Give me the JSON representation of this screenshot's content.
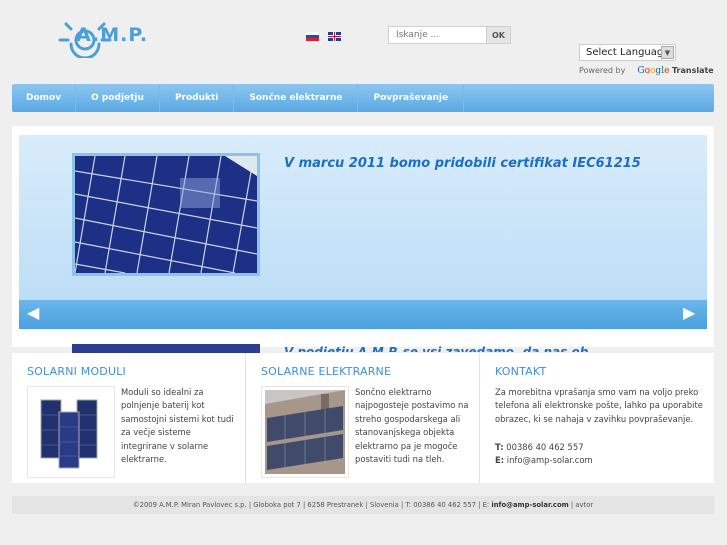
{
  "header": {
    "logo_text": "A.M.P.",
    "search": {
      "placeholder": "Iskanje ...",
      "button_label": "OK"
    },
    "language_select": {
      "selected": "Select Language"
    },
    "powered_by": "Powered by",
    "google": [
      "G",
      "o",
      "o",
      "g",
      "l",
      "e"
    ],
    "translate": "Translate",
    "flags": [
      "flag-si-icon",
      "flag-gb-icon"
    ]
  },
  "nav": {
    "items": [
      {
        "label": "Domov"
      },
      {
        "label": "O podjetju"
      },
      {
        "label": "Produkti"
      },
      {
        "label": "Sončne elektrarne"
      },
      {
        "label": "Povpraševanje"
      }
    ]
  },
  "slider": {
    "current_title": "V marcu 2011 bomo pridobili certifikat IEC61215",
    "next_title": "V podjetju A.M.P. se vsi zavedamo, da nas ob kakovostnih",
    "prev_arrow": "◀",
    "next_arrow": "▶"
  },
  "boxes": {
    "solar_modules": {
      "title": "SOLARNI MODULI",
      "text": "Moduli so idealni za polnjenje baterij kot samostojni sistemi kot tudi za večje sisteme integrirane v solarne elektrarne."
    },
    "solar_plants": {
      "title": "SOLARNE ELEKTRARNE",
      "text": "Sončno elektrarno najpogosteje postavimo na streho gospodarskega ali stanovanjskega objekta elektrarno pa je mogoče postaviti tudi na tleh."
    },
    "contact": {
      "title": "KONTAKT",
      "text": "Za morebitna vprašanja smo vam na voljo preko telefona ali elektronske pošte, lahko pa uporabite obrazec, ki se nahaja v zavihku povpraševanje.",
      "phone_label": "T:",
      "phone": "00386 40 462 557",
      "email_label": "E:",
      "email": "info@amp-solar.com"
    }
  },
  "footer": {
    "text": "©2009 A.M.P. Miran Pavlovec s.p. | Globoka pot 7 | 6258 Prestranek | Slovenia | T: 00386 40 462 557 | E:",
    "email": "info@amp-solar.com",
    "separator": "|",
    "author": "avtor"
  },
  "colors": {
    "accent": "#4a9fd8",
    "nav": "#5aa9e4",
    "title": "#1d6fc2"
  }
}
